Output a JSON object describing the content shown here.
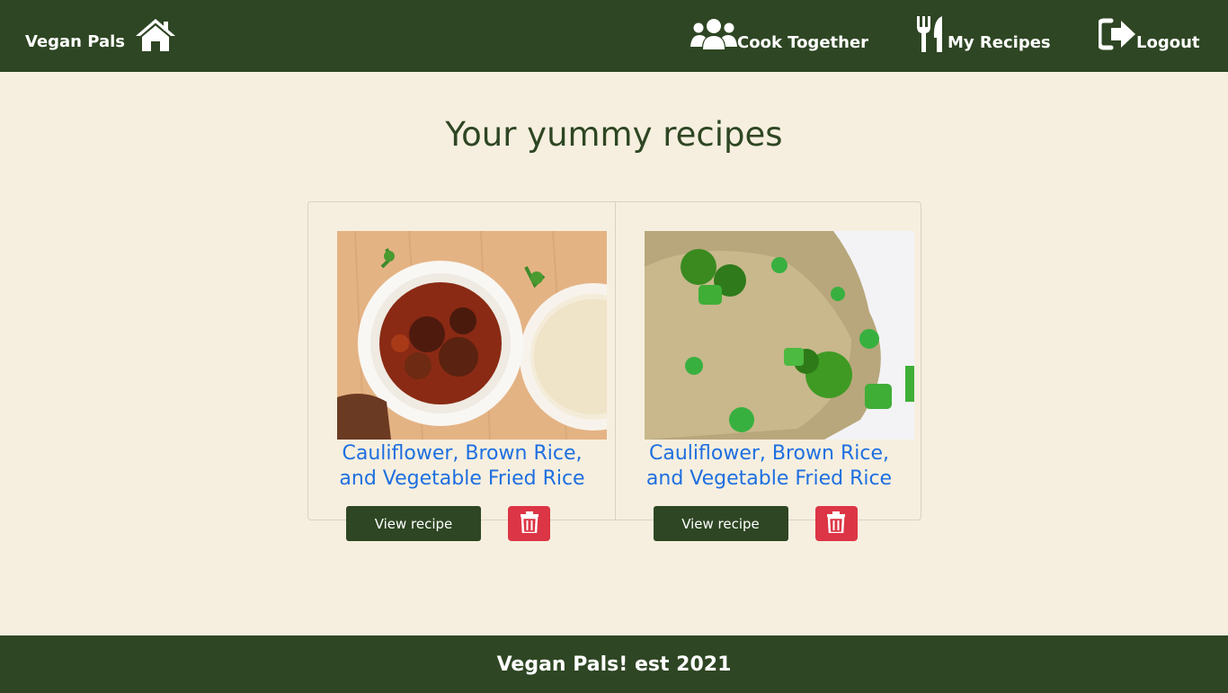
{
  "navbar": {
    "brand": "Vegan Pals",
    "home_icon": "home-icon",
    "links": [
      {
        "label": "Cook Together",
        "icon": "users-icon"
      },
      {
        "label": "My Recipes",
        "icon": "utensils-icon"
      },
      {
        "label": "Logout",
        "icon": "sign-out-icon"
      }
    ]
  },
  "main": {
    "title": "Your yummy recipes",
    "recipes": [
      {
        "title": "Cauliflower, Brown Rice, and Vegetable Fried Rice",
        "image": "stew-with-rice-photo",
        "view_label": "View recipe",
        "delete_icon": "trash-icon"
      },
      {
        "title": "Cauliflower, Brown Rice, and Vegetable Fried Rice",
        "image": "vegetable-fried-rice-photo",
        "view_label": "View recipe",
        "delete_icon": "trash-icon"
      }
    ]
  },
  "footer": {
    "text": "Vegan Pals! est 2021"
  },
  "colors": {
    "nav_bg": "#2e4623",
    "page_bg": "#f6efdf",
    "link_blue": "#1e6fe0",
    "delete_red": "#dc3545"
  }
}
